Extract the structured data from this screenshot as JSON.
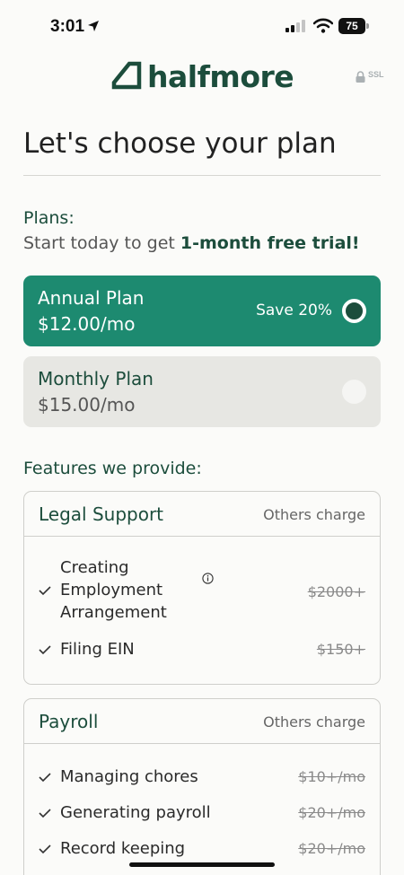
{
  "status_bar": {
    "time": "3:01",
    "battery": "75"
  },
  "brand": {
    "name": "halfmore",
    "ssl": "SSL"
  },
  "page": {
    "title": "Let's choose your plan"
  },
  "plans": {
    "label": "Plans:",
    "subtitle_prefix": "Start today to get ",
    "subtitle_highlight": "1-month free trial!",
    "items": [
      {
        "name": "Annual Plan",
        "price": "$12.00/mo",
        "badge": "Save 20%",
        "selected": true
      },
      {
        "name": "Monthly Plan",
        "price": "$15.00/mo",
        "selected": false
      }
    ]
  },
  "features": {
    "label": "Features we provide:",
    "groups": [
      {
        "title": "Legal Support",
        "charge_label": "Others charge",
        "items": [
          {
            "lines": [
              "Creating",
              "Employment",
              "Arrangement"
            ],
            "price": "$2000+"
          },
          {
            "lines": [
              "Filing EIN"
            ],
            "price": "$150+"
          }
        ]
      },
      {
        "title": "Payroll",
        "charge_label": "Others charge",
        "items": [
          {
            "lines": [
              "Managing chores"
            ],
            "price": "$10+/mo"
          },
          {
            "lines": [
              "Generating payroll"
            ],
            "price": "$20+/mo"
          },
          {
            "lines": [
              "Record keeping"
            ],
            "price": "$20+/mo"
          }
        ]
      }
    ]
  },
  "colors": {
    "brand_dark": "#1c4d3c",
    "accent": "#1d8a70",
    "muted_card": "#e7e7e3"
  },
  "icons": [
    "location-arrow-icon",
    "signal-icon",
    "wifi-icon",
    "battery-icon",
    "brand-logo-icon",
    "lock-icon",
    "check-icon",
    "info-icon",
    "radio-icon"
  ]
}
